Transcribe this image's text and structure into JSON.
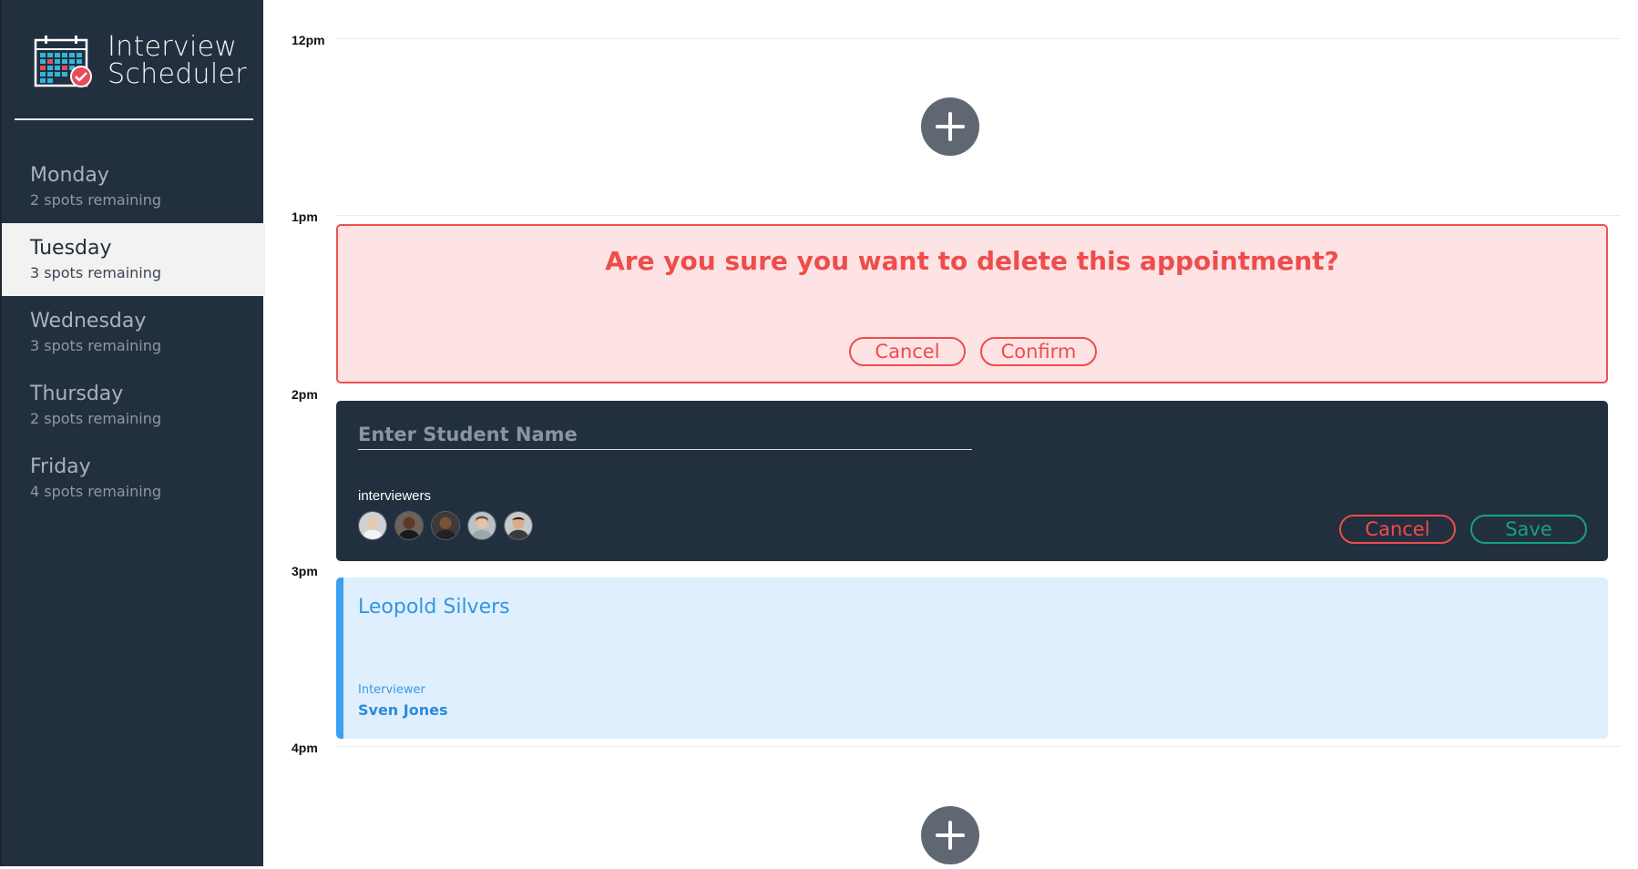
{
  "app": {
    "title_line1": "Interview",
    "title_line2": "Scheduler",
    "logo_icon": "calendar-check-icon"
  },
  "days": [
    {
      "name": "Monday",
      "spots": "2 spots remaining",
      "selected": false
    },
    {
      "name": "Tuesday",
      "spots": "3 spots remaining",
      "selected": true
    },
    {
      "name": "Wednesday",
      "spots": "3 spots remaining",
      "selected": false
    },
    {
      "name": "Thursday",
      "spots": "2 spots remaining",
      "selected": false
    },
    {
      "name": "Friday",
      "spots": "4 spots remaining",
      "selected": false
    }
  ],
  "times": [
    "12pm",
    "1pm",
    "2pm",
    "3pm",
    "4pm"
  ],
  "add_icon": "plus-icon",
  "confirm": {
    "message": "Are you sure you want to delete this appointment?",
    "cancel": "Cancel",
    "confirm": "Confirm"
  },
  "form": {
    "placeholder": "Enter Student Name",
    "value": "",
    "interviewers_label": "interviewers",
    "avatar_count": 5,
    "cancel": "Cancel",
    "save": "Save"
  },
  "show": {
    "student": "Leopold Silvers",
    "interviewer_label": "Interviewer",
    "interviewer": "Sven Jones"
  },
  "colors": {
    "sidebar": "#222f3e",
    "danger": "#ef4c4c",
    "success": "#16a085",
    "accent_blue": "#3aa0f0",
    "add_button": "#5f6872"
  }
}
